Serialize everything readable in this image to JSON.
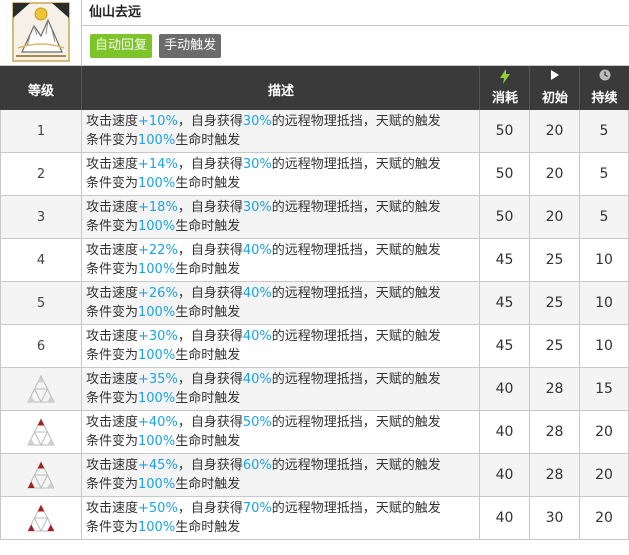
{
  "skill": {
    "name": "仙山去远",
    "tags": [
      "自动回复",
      "手动触发"
    ]
  },
  "table": {
    "headers": {
      "level": "等级",
      "desc": "描述",
      "cost": "消耗",
      "initial": "初始",
      "duration": "持续"
    },
    "rows": [
      {
        "level": "1",
        "d1": "攻击速度",
        "v1": "+10%",
        "d2": "，自身获得",
        "v2": "30%",
        "d3": "的远程物理抵挡，天赋的触发",
        "d4": "条件变为",
        "v3": "100%",
        "d5": "生命时触发",
        "cost": "50",
        "init": "20",
        "dur": "5"
      },
      {
        "level": "2",
        "d1": "攻击速度",
        "v1": "+14%",
        "d2": "，自身获得",
        "v2": "30%",
        "d3": "的远程物理抵挡，天赋的触发",
        "d4": "条件变为",
        "v3": "100%",
        "d5": "生命时触发",
        "cost": "50",
        "init": "20",
        "dur": "5"
      },
      {
        "level": "3",
        "d1": "攻击速度",
        "v1": "+18%",
        "d2": "，自身获得",
        "v2": "30%",
        "d3": "的远程物理抵挡，天赋的触发",
        "d4": "条件变为",
        "v3": "100%",
        "d5": "生命时触发",
        "cost": "50",
        "init": "20",
        "dur": "5"
      },
      {
        "level": "4",
        "d1": "攻击速度",
        "v1": "+22%",
        "d2": "，自身获得",
        "v2": "40%",
        "d3": "的远程物理抵挡，天赋的触发",
        "d4": "条件变为",
        "v3": "100%",
        "d5": "生命时触发",
        "cost": "45",
        "init": "25",
        "dur": "10"
      },
      {
        "level": "5",
        "d1": "攻击速度",
        "v1": "+26%",
        "d2": "，自身获得",
        "v2": "40%",
        "d3": "的远程物理抵挡，天赋的触发",
        "d4": "条件变为",
        "v3": "100%",
        "d5": "生命时触发",
        "cost": "45",
        "init": "25",
        "dur": "10"
      },
      {
        "level": "6",
        "d1": "攻击速度",
        "v1": "+30%",
        "d2": "，自身获得",
        "v2": "40%",
        "d3": "的远程物理抵挡，天赋的触发",
        "d4": "条件变为",
        "v3": "100%",
        "d5": "生命时触发",
        "cost": "45",
        "init": "25",
        "dur": "10"
      },
      {
        "level": "",
        "mastery": 0,
        "d1": "攻击速度",
        "v1": "+35%",
        "d2": "，自身获得",
        "v2": "40%",
        "d3": "的远程物理抵挡，天赋的触发",
        "d4": "条件变为",
        "v3": "100%",
        "d5": "生命时触发",
        "cost": "40",
        "init": "28",
        "dur": "15"
      },
      {
        "level": "",
        "mastery": 1,
        "d1": "攻击速度",
        "v1": "+40%",
        "d2": "，自身获得",
        "v2": "50%",
        "d3": "的远程物理抵挡，天赋的触发",
        "d4": "条件变为",
        "v3": "100%",
        "d5": "生命时触发",
        "cost": "40",
        "init": "28",
        "dur": "20"
      },
      {
        "level": "",
        "mastery": 2,
        "d1": "攻击速度",
        "v1": "+45%",
        "d2": "，自身获得",
        "v2": "60%",
        "d3": "的远程物理抵挡，天赋的触发",
        "d4": "条件变为",
        "v3": "100%",
        "d5": "生命时触发",
        "cost": "40",
        "init": "28",
        "dur": "20"
      },
      {
        "level": "",
        "mastery": 3,
        "d1": "攻击速度",
        "v1": "+50%",
        "d2": "，自身获得",
        "v2": "70%",
        "d3": "的远程物理抵挡，天赋的触发",
        "d4": "条件变为",
        "v3": "100%",
        "d5": "生命时触发",
        "cost": "40",
        "init": "30",
        "dur": "20"
      }
    ]
  },
  "colors": {
    "highlight": "#1aa3e6",
    "tag_auto": "#7cc427",
    "tag_manual": "#6b6b6b",
    "header_bg": "#3a3a3a",
    "mastery_on": "#a51d1d",
    "mastery_off": "#cfcfcf"
  },
  "icons": {
    "skill": "mountain-skill-icon",
    "cost": "lightning-icon",
    "initial": "play-triangle-icon",
    "duration": "clock-icon",
    "mastery": "mastery-triangle-icon"
  }
}
